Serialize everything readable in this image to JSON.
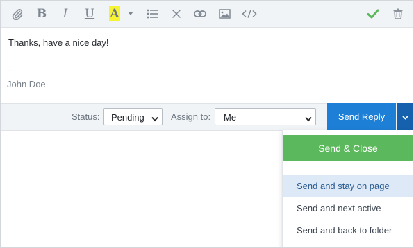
{
  "toolbar": {
    "bold_glyph": "B",
    "italic_glyph": "I",
    "underline_glyph": "U",
    "highlight_glyph": "A",
    "highlight_color": "#f6f234",
    "check_color": "#5cb85c",
    "icons": [
      "paperclip-icon",
      "bold-icon",
      "italic-icon",
      "underline-icon",
      "highlight-icon",
      "caret-down-icon",
      "list-icon",
      "clear-format-icon",
      "link-icon",
      "image-icon",
      "code-icon",
      "check-icon",
      "trash-icon"
    ]
  },
  "editor": {
    "line1": "Thanks, have a nice day!",
    "sig_dashes": "--",
    "sig_name": "John Doe"
  },
  "actions": {
    "status_label": "Status:",
    "status_value": "Pending",
    "assign_label": "Assign to:",
    "assign_value": "Me",
    "send_reply": "Send Reply",
    "send_reply_color": "#1e7fd6"
  },
  "dropdown": {
    "send_close": "Send & Close",
    "send_close_color": "#5cb85c",
    "items": [
      {
        "label": "Send and stay on page",
        "active": true
      },
      {
        "label": "Send and next active",
        "active": false
      },
      {
        "label": "Send and back to folder",
        "active": false
      }
    ]
  }
}
